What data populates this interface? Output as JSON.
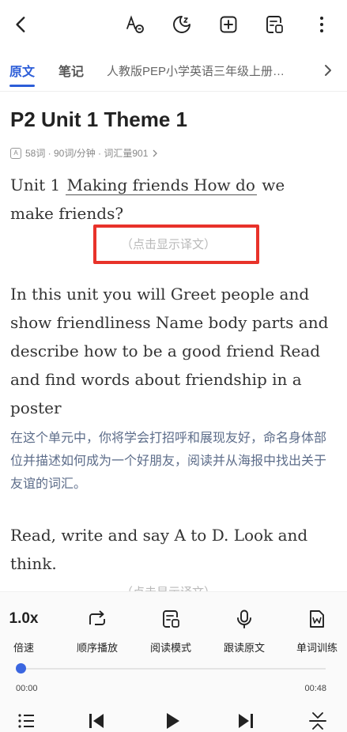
{
  "topbar": {
    "icons": [
      "back-icon",
      "translate-icon",
      "night-mode-icon",
      "add-icon",
      "reading-mode-icon",
      "more-icon"
    ]
  },
  "tabs": {
    "original": "原文",
    "notes": "笔记",
    "book": "人教版PEP小学英语三年级上册…"
  },
  "article": {
    "title": "P2 Unit 1 Theme 1",
    "meta": "58词 · 90词/分钟 · 词汇量901",
    "meta_icon_letter": "A",
    "para1_prefix": "Unit 1 ",
    "para1_underlined": "Making friends How do",
    "para1_suffix": " we make friends?",
    "translate_hint": "（点击显示译文）",
    "para2": "In this unit you will Greet people and show friendliness Name body parts and describe how to be a good friend Read and find words about friendship in a poster",
    "para2_translation": "在这个单元中，你将学会打招呼和展现友好，命名身体部位并描述如何成为一个好朋友，阅读并从海报中找出关于友谊的词汇。",
    "para3": "Read, write and say A to D. Look and think.",
    "translate_hint_2": "（点击显示译文）"
  },
  "player": {
    "speed": "1.0x",
    "speed_label": "倍速",
    "order_play": "顺序播放",
    "reading_mode": "阅读模式",
    "follow_read": "跟读原文",
    "word_training": "单词训练",
    "progress": 0.0,
    "time_current": "00:00",
    "time_total": "00:48"
  },
  "colors": {
    "accent": "#2c5dd8",
    "highlight_box": "#e8322a",
    "translation_text": "#5d6d8a"
  }
}
